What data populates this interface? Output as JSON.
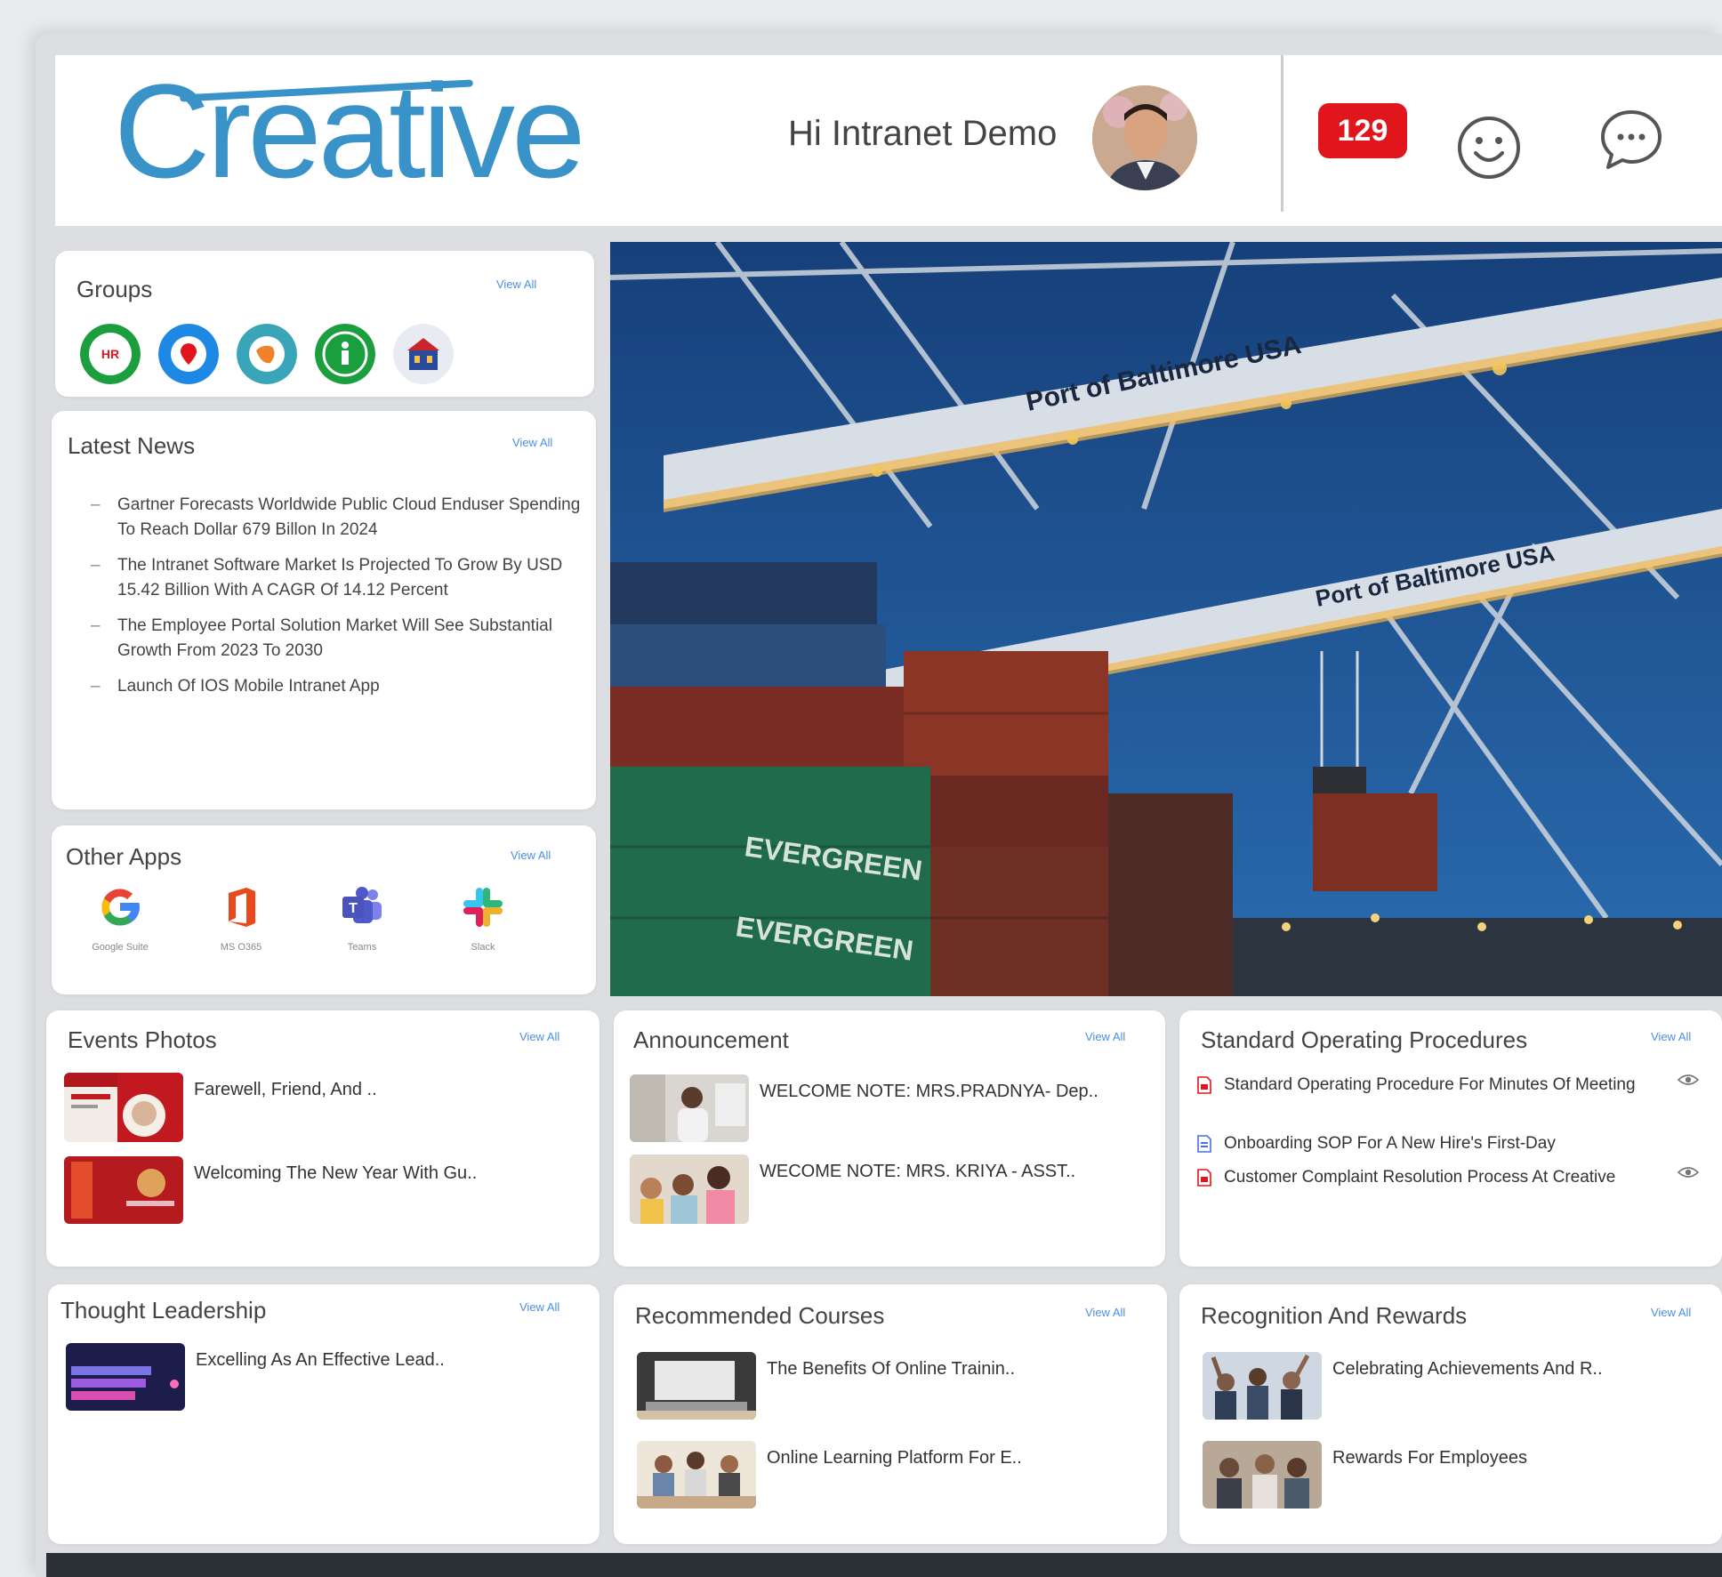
{
  "header": {
    "logo_text": "Creative",
    "greeting": "Hi Intranet Demo",
    "notification_count": "129"
  },
  "groups": {
    "title": "Groups",
    "view_all": "View All"
  },
  "latest_news": {
    "title": "Latest News",
    "view_all": "View All",
    "items": [
      "Gartner Forecasts Worldwide Public Cloud Enduser Spending To Reach Dollar 679 Billon In 2024",
      "The Intranet Software Market Is Projected To Grow By USD 15.42 Billion With A CAGR Of 14.12 Percent",
      "The Employee Portal Solution Market Will See Substantial Growth From 2023 To 2030",
      "Launch Of IOS Mobile Intranet App"
    ]
  },
  "other_apps": {
    "title": "Other Apps",
    "view_all": "View All",
    "apps": [
      {
        "label": "Google Suite",
        "icon": "google-icon"
      },
      {
        "label": "MS O365",
        "icon": "office-icon"
      },
      {
        "label": "Teams",
        "icon": "teams-icon"
      },
      {
        "label": "Slack",
        "icon": "slack-icon"
      }
    ]
  },
  "hero": {
    "sign_1": "Port of Baltimore  USA",
    "sign_2": "Port of Baltimore  USA",
    "container_1": "EVERGREEN",
    "container_2": "EVERGREEN"
  },
  "events_photos": {
    "title": "Events Photos",
    "view_all": "View All",
    "items": [
      {
        "text": "Farewell, Friend, And .."
      },
      {
        "text": "Welcoming The New Year With Gu.."
      }
    ]
  },
  "announcement": {
    "title": "Announcement",
    "view_all": "View All",
    "items": [
      {
        "text": "WELCOME NOTE: MRS.PRADNYA- Dep.."
      },
      {
        "text": "WECOME NOTE: MRS. KRIYA - ASST.."
      }
    ]
  },
  "sop": {
    "title": "Standard Operating Procedures",
    "view_all": "View All",
    "items": [
      {
        "text": "Standard Operating Procedure For Minutes Of Meeting",
        "type": "pdf"
      },
      {
        "text": "Onboarding SOP For A New Hire's First-Day",
        "type": "doc"
      },
      {
        "text": "Customer Complaint Resolution Process At Creative",
        "type": "pdf"
      }
    ]
  },
  "thought_leadership": {
    "title": "Thought Leadership",
    "view_all": "View All",
    "items": [
      {
        "text": "Excelling As An Effective Lead.."
      }
    ]
  },
  "recommended_courses": {
    "title": "Recommended Courses",
    "view_all": "View All",
    "items": [
      {
        "text": "The Benefits Of Online Trainin.."
      },
      {
        "text": "Online Learning Platform For E.."
      }
    ]
  },
  "recognition": {
    "title": "Recognition And Rewards",
    "view_all": "View All",
    "items": [
      {
        "text": "Celebrating Achievements And R.."
      },
      {
        "text": "Rewards For Employees"
      }
    ]
  },
  "colors": {
    "brand_blue": "#3a93c8",
    "badge_red": "#e0161c",
    "link_blue": "#4a90e2",
    "page_bg": "#e9ebee"
  }
}
